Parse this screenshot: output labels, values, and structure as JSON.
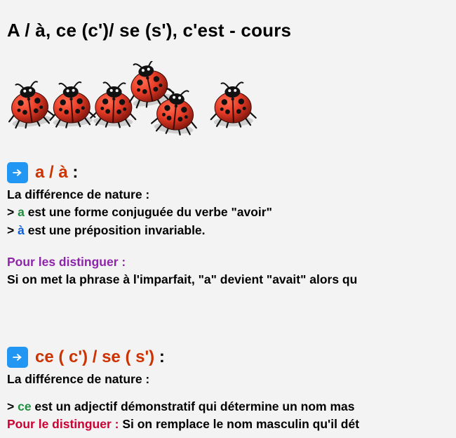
{
  "title": "A / à, ce (c')/ se (s'), c'est - cours",
  "section1": {
    "heading": "a / à",
    "colon": " :",
    "l1": "La différence de nature :",
    "l2_pre": "> ",
    "l2_kw": "a",
    "l2_post": " est une forme conjuguée du verbe \"avoir\"",
    "l3_pre": "> ",
    "l3_kw": "à",
    "l3_post": " est une préposition invariable.",
    "sub": "Pour les distinguer :",
    "sub_line": "Si on met la phrase à l'imparfait, \"a\" devient \"avait\" alors qu"
  },
  "section2": {
    "heading": "ce ( c') / se ( s')",
    "colon": " :",
    "l1": "La différence de nature :",
    "l2_pre": "> ",
    "l2_kw": "ce",
    "l2_post": " est un adjectif démonstratif qui détermine un nom mas",
    "sub": "Pour le distinguer : ",
    "sub_line": "Si on remplace le nom masculin qu'il dét"
  }
}
